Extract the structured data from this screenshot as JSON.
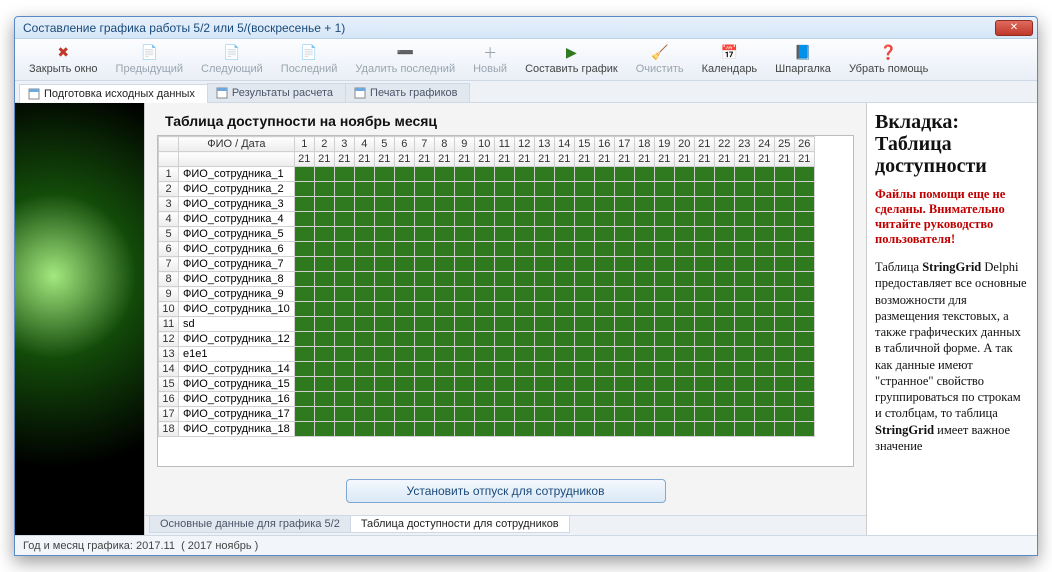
{
  "window": {
    "title": "Составление графика работы 5/2 или 5/(воскресенье + 1)"
  },
  "toolbar": [
    {
      "id": "close-window",
      "label": "Закрыть окно",
      "icon": "✖",
      "color": "#c0392b",
      "enabled": true
    },
    {
      "id": "prev",
      "label": "Предыдущий",
      "icon": "📄",
      "enabled": false
    },
    {
      "id": "next",
      "label": "Следующий",
      "icon": "📄",
      "enabled": false
    },
    {
      "id": "last",
      "label": "Последний",
      "icon": "📄",
      "enabled": false
    },
    {
      "id": "delete-last",
      "label": "Удалить последний",
      "icon": "➖",
      "enabled": false
    },
    {
      "id": "new",
      "label": "Новый",
      "icon": "＋",
      "enabled": false
    },
    {
      "id": "compose",
      "label": "Составить график",
      "icon": "▶",
      "color": "#2f7a1f",
      "enabled": true
    },
    {
      "id": "clear",
      "label": "Очистить",
      "icon": "🧹",
      "enabled": false
    },
    {
      "id": "calendar",
      "label": "Календарь",
      "icon": "📅",
      "enabled": true
    },
    {
      "id": "cheatsheet",
      "label": "Шпаргалка",
      "icon": "📘",
      "enabled": true
    },
    {
      "id": "remove-help",
      "label": "Убрать помощь",
      "icon": "❓",
      "color": "#c0392b",
      "enabled": true
    }
  ],
  "doctabs": [
    {
      "id": "src",
      "label": "Подготовка исходных данных",
      "active": true
    },
    {
      "id": "res",
      "label": "Результаты расчета",
      "active": false
    },
    {
      "id": "print",
      "label": "Печать графиков",
      "active": false
    }
  ],
  "heading": "Таблица доступности на ноябрь месяц",
  "grid": {
    "name_header": "ФИО / Дата",
    "days": [
      1,
      2,
      3,
      4,
      5,
      6,
      7,
      8,
      9,
      10,
      11,
      12,
      13,
      14,
      15,
      16,
      17,
      18,
      19,
      20,
      21,
      22,
      23,
      24,
      25,
      26
    ],
    "row2_value": "21",
    "rows": [
      {
        "n": 1,
        "name": "ФИО_сотрудника_1"
      },
      {
        "n": 2,
        "name": "ФИО_сотрудника_2"
      },
      {
        "n": 3,
        "name": "ФИО_сотрудника_3"
      },
      {
        "n": 4,
        "name": "ФИО_сотрудника_4"
      },
      {
        "n": 5,
        "name": "ФИО_сотрудника_5"
      },
      {
        "n": 6,
        "name": "ФИО_сотрудника_6"
      },
      {
        "n": 7,
        "name": "ФИО_сотрудника_7"
      },
      {
        "n": 8,
        "name": "ФИО_сотрудника_8"
      },
      {
        "n": 9,
        "name": "ФИО_сотрудника_9"
      },
      {
        "n": 10,
        "name": "ФИО_сотрудника_10"
      },
      {
        "n": 11,
        "name": "sd"
      },
      {
        "n": 12,
        "name": "ФИО_сотрудника_12"
      },
      {
        "n": 13,
        "name": "e1e1"
      },
      {
        "n": 14,
        "name": "ФИО_сотрудника_14"
      },
      {
        "n": 15,
        "name": "ФИО_сотрудника_15"
      },
      {
        "n": 16,
        "name": "ФИО_сотрудника_16"
      },
      {
        "n": 17,
        "name": "ФИО_сотрудника_17"
      },
      {
        "n": 18,
        "name": "ФИО_сотрудника_18"
      }
    ]
  },
  "button": {
    "set_vacation": "Установить отпуск для сотрудников"
  },
  "subtabs": [
    {
      "id": "base",
      "label": "Основные данные для графика 5/2",
      "active": false
    },
    {
      "id": "avail",
      "label": "Таблица доступности для сотрудников",
      "active": true
    }
  ],
  "help": {
    "title": "Вкладка: Таблица доступности",
    "warning": "Файлы помощи еще не сделаны. Внимательно читайте руководство пользователя!",
    "body": "Таблица StringGrid Delphi предоставляет все основные возможности для размещения текстовых, а также графических данных в табличной форме. А так как данные имеют \"странное\" свойство группироваться по строкам и столбцам, то таблица StringGrid имеет важное значение"
  },
  "status": {
    "label": "Год и месяц графика:",
    "value": "2017.11",
    "extra": "( 2017  ноябрь )"
  }
}
